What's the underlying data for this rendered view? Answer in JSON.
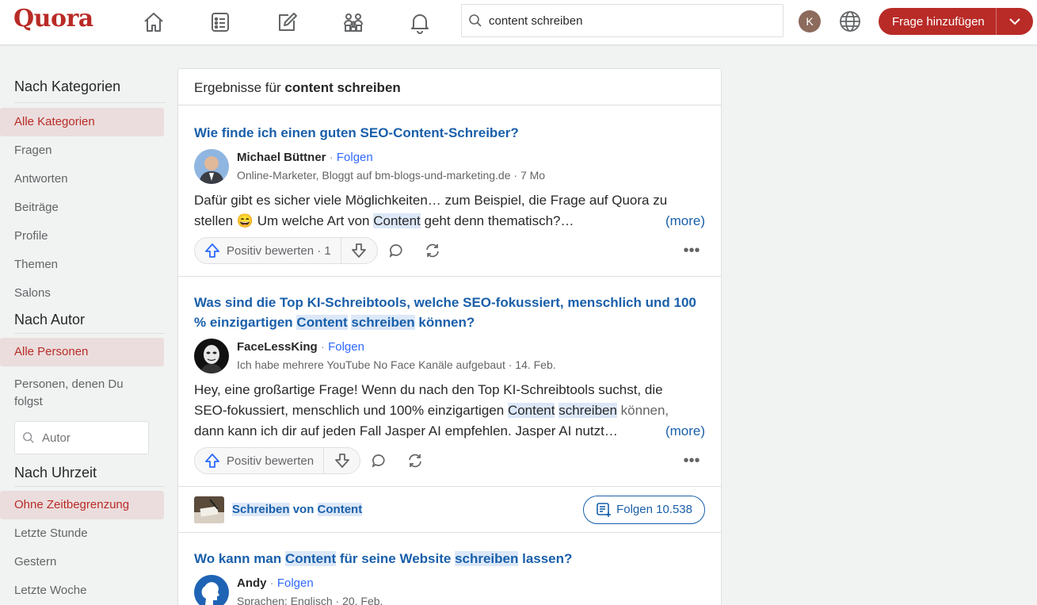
{
  "header": {
    "logo": "Quora",
    "search_value": "content schreiben",
    "avatar_letter": "K",
    "add_question_label": "Frage hinzufügen"
  },
  "sidebar": {
    "sections": [
      {
        "title": "Nach Kategorien",
        "items": [
          "Alle Kategorien",
          "Fragen",
          "Antworten",
          "Beiträge",
          "Profile",
          "Themen",
          "Salons"
        ]
      },
      {
        "title": "Nach Autor",
        "items": [
          "Alle Personen",
          "Personen, denen Du folgst"
        ]
      },
      {
        "title": "Nach Uhrzeit",
        "items": [
          "Ohne Zeitbegrenzung",
          "Letzte Stunde",
          "Gestern",
          "Letzte Woche"
        ]
      }
    ],
    "author_placeholder": "Autor"
  },
  "results": {
    "prefix": "Ergebnisse für",
    "query": "content schreiben"
  },
  "items": [
    {
      "title": "Wie finde ich einen guten SEO-Content-Schreiber?",
      "author": "Michael Büttner",
      "follow": "Folgen",
      "credential": "Online-Marketer, Bloggt auf bm-blogs-und-marketing.de · 7 Mo",
      "snippet_1": "Dafür gibt es sicher viele Möglichkeiten… zum Beispiel, die Frage auf Quora zu",
      "snippet_2a": "stellen ",
      "emoji": "😄",
      "snippet_2b": "  Um welche Art von ",
      "snippet_2c": "Content",
      "snippet_2d": " geht denn thematisch?…",
      "more": "(more)",
      "upvote": "Positiv bewerten · 1"
    },
    {
      "title_a": "Was sind die Top KI-Schreibtools, welche SEO-fokussiert, menschlich und 100 % einzigartigen ",
      "title_b": "Content",
      "title_c": " ",
      "title_d": "schreiben",
      "title_e": " können?",
      "author": "FaceLessKing",
      "follow": "Folgen",
      "credential": "Ich habe mehrere YouTube No Face Kanäle aufgebaut · 14. Feb.",
      "snippet_1": "Hey, eine großartige Frage! Wenn du nach den Top KI-Schreibtools suchst, die",
      "snippet_2a": "SEO-fokussiert, menschlich und 100% einzigartigen ",
      "snippet_2b": "Content",
      "snippet_2c": " ",
      "snippet_2d": "schreiben",
      "snippet_2e": " können,",
      "snippet_3": "dann kann ich dir auf jeden Fall Jasper AI empfehlen. Jasper AI nutzt…",
      "more": "(more)",
      "upvote": "Positiv bewerten"
    }
  ],
  "topic": {
    "part_a": "Schreiben",
    "part_b": " von ",
    "part_c": "Content",
    "follow": "Folgen 10.538"
  },
  "item3": {
    "title_a": "Wo kann man ",
    "title_b": "Content",
    "title_c": " für seine Website ",
    "title_d": "schreiben",
    "title_e": " lassen?",
    "author": "Andy",
    "follow": "Folgen",
    "credential": "Sprachen: Englisch · 20. Feb."
  }
}
